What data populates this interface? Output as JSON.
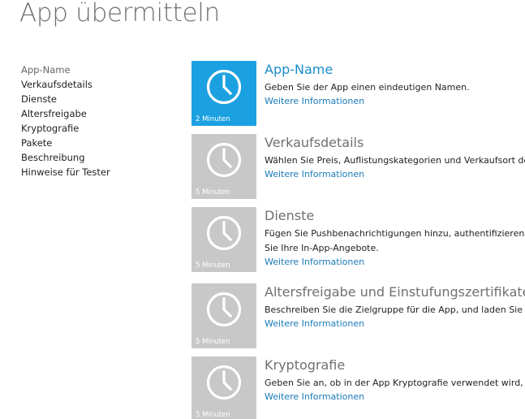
{
  "page": {
    "title": "App übermitteln"
  },
  "colors": {
    "accent": "#1ba1e2",
    "tile_inactive": "#c8c8c8",
    "link": "#1a7ab8",
    "title_active": "#1a8ecb"
  },
  "sidebar": {
    "items": [
      {
        "label": "App-Name",
        "active": true
      },
      {
        "label": "Verkaufsdetails",
        "active": false
      },
      {
        "label": "Dienste",
        "active": false
      },
      {
        "label": "Altersfreigabe",
        "active": false
      },
      {
        "label": "Kryptografie",
        "active": false
      },
      {
        "label": "Pakete",
        "active": false
      },
      {
        "label": "Beschreibung",
        "active": false
      },
      {
        "label": "Hinweise für Tester",
        "active": false
      }
    ]
  },
  "sections": [
    {
      "icon": "clock-icon",
      "time": "2 Minuten",
      "title": "App-Name",
      "description": "Geben Sie der App einen eindeutigen Namen.",
      "more": "Weitere Informationen",
      "active": true
    },
    {
      "icon": "clock-icon",
      "time": "5 Minuten",
      "title": "Verkaufsdetails",
      "description": "Wählen Sie Preis, Auflistungskategorien und Verkaufsort der App",
      "more": "Weitere Informationen",
      "active": false
    },
    {
      "icon": "clock-icon",
      "time": "5 Minuten",
      "title": "Dienste",
      "description": "Fügen Sie Pushbenachrichtigungen hinzu, authentifizieren Sie Ihre In-App-Angebote.",
      "more": "Weitere Informationen",
      "active": false
    },
    {
      "icon": "clock-icon",
      "time": "5 Minuten",
      "title": "Altersfreigabe und Einstufungszertifikate",
      "description": "Beschreiben Sie die Zielgruppe für die App, und laden Sie Ihre",
      "more": "Weitere Informationen",
      "active": false
    },
    {
      "icon": "clock-icon",
      "time": "5 Minuten",
      "title": "Kryptografie",
      "description": "Geben Sie an, ob in der App Kryptografie verwendet wird, und",
      "more": "Weitere Informationen",
      "active": false
    }
  ]
}
